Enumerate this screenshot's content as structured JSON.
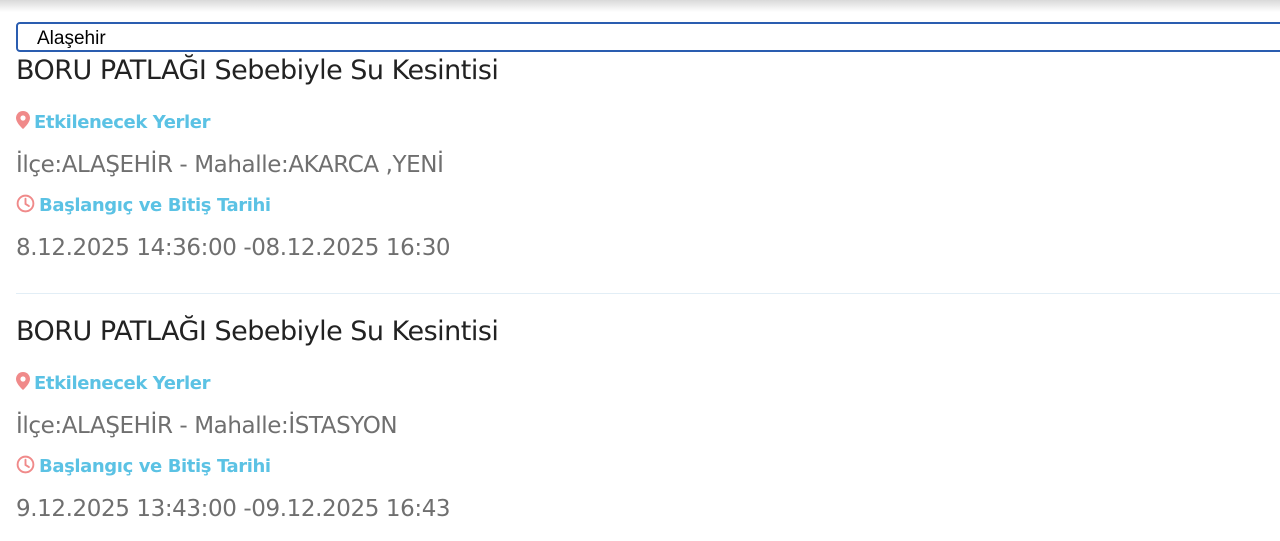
{
  "filter": {
    "selected_district": "Alaşehir"
  },
  "notices": [
    {
      "title": "BORU PATLAĞI Sebebiyle Su Kesintisi",
      "places_label": "Etkilenecek Yerler",
      "places_value": "İlçe:ALAŞEHİR - Mahalle:AKARCA ,YENİ",
      "dates_label": "Başlangıç ve Bitiş Tarihi",
      "dates_value": "8.12.2025 14:36:00 -08.12.2025 16:30"
    },
    {
      "title": "BORU PATLAĞI Sebebiyle Su Kesintisi",
      "places_label": "Etkilenecek Yerler",
      "places_value": "İlçe:ALAŞEHİR - Mahalle:İSTASYON",
      "dates_label": "Başlangıç ve Bitiş Tarihi",
      "dates_value": "9.12.2025 13:43:00 -09.12.2025 16:43"
    }
  ],
  "colors": {
    "label_accent": "#5bc2e4",
    "icon_accent": "#f08a8a",
    "select_border": "#2a5db0"
  },
  "icons": {
    "places": "map-pin-icon",
    "dates": "clock-icon"
  }
}
